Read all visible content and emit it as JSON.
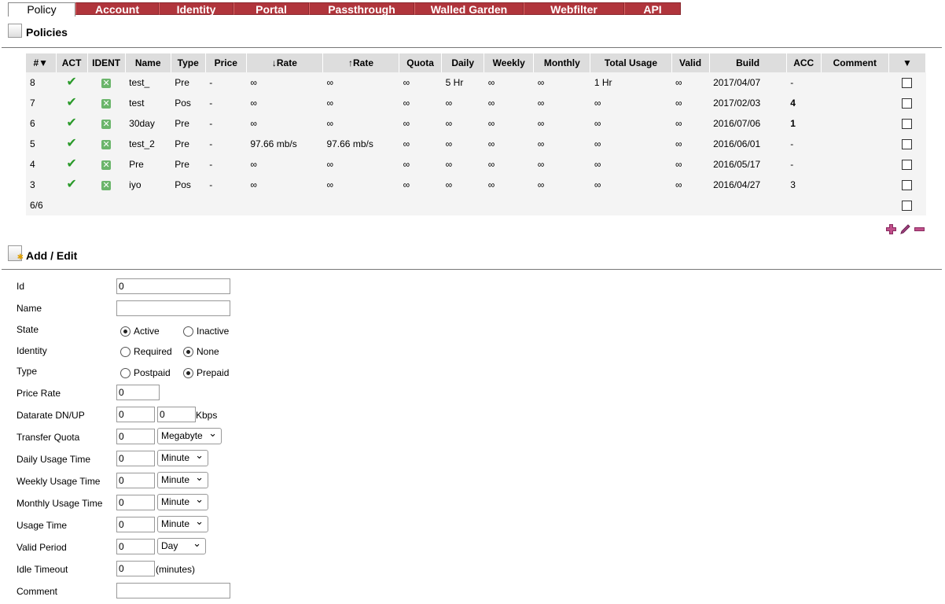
{
  "tabs": [
    "Policy",
    "Account",
    "Identity",
    "Portal",
    "Passthrough",
    "Walled Garden",
    "Webfilter",
    "API"
  ],
  "policies_title": "Policies",
  "addedit_title": "Add / Edit",
  "table": {
    "headers": [
      "#▼",
      "ACT",
      "IDENT",
      "Name",
      "Type",
      "Price",
      "↓Rate",
      "↑Rate",
      "Quota",
      "Daily",
      "Weekly",
      "Monthly",
      "Total Usage",
      "Valid",
      "Build",
      "ACC",
      "Comment",
      "▼"
    ],
    "rows": [
      {
        "id": "8",
        "name": "test_",
        "type": "Pre",
        "price": "-",
        "down": "∞",
        "up": "∞",
        "quota": "∞",
        "daily": "5 Hr",
        "weekly": "∞",
        "monthly": "∞",
        "total": "1 Hr",
        "valid": "∞",
        "build": "2017/04/07",
        "acc": "-",
        "comment": ""
      },
      {
        "id": "7",
        "name": "test",
        "type": "Pos",
        "price": "-",
        "down": "∞",
        "up": "∞",
        "quota": "∞",
        "daily": "∞",
        "weekly": "∞",
        "monthly": "∞",
        "total": "∞",
        "valid": "∞",
        "build": "2017/02/03",
        "acc": "4",
        "comment": ""
      },
      {
        "id": "6",
        "name": "30day",
        "type": "Pre",
        "price": "-",
        "down": "∞",
        "up": "∞",
        "quota": "∞",
        "daily": "∞",
        "weekly": "∞",
        "monthly": "∞",
        "total": "∞",
        "valid": "∞",
        "build": "2016/07/06",
        "acc": "1",
        "comment": ""
      },
      {
        "id": "5",
        "name": "test_2",
        "type": "Pre",
        "price": "-",
        "down": "97.66 mb/s",
        "up": "97.66 mb/s",
        "quota": "∞",
        "daily": "∞",
        "weekly": "∞",
        "monthly": "∞",
        "total": "∞",
        "valid": "∞",
        "build": "2016/06/01",
        "acc": "-",
        "comment": ""
      },
      {
        "id": "4",
        "name": "Pre",
        "type": "Pre",
        "price": "-",
        "down": "∞",
        "up": "∞",
        "quota": "∞",
        "daily": "∞",
        "weekly": "∞",
        "monthly": "∞",
        "total": "∞",
        "valid": "∞",
        "build": "2016/05/17",
        "acc": "-",
        "comment": ""
      },
      {
        "id": "3",
        "name": "iyo",
        "type": "Pos",
        "price": "-",
        "down": "∞",
        "up": "∞",
        "quota": "∞",
        "daily": "∞",
        "weekly": "∞",
        "monthly": "∞",
        "total": "∞",
        "valid": "∞",
        "build": "2016/04/27",
        "acc": "3",
        "comment": ""
      }
    ],
    "footer_count": "6/6"
  },
  "form": {
    "id_label": "Id",
    "id_value": "0",
    "name_label": "Name",
    "name_value": "",
    "state_label": "State",
    "state_active": "Active",
    "state_inactive": "Inactive",
    "identity_label": "Identity",
    "identity_required": "Required",
    "identity_none": "None",
    "type_label": "Type",
    "type_postpaid": "Postpaid",
    "type_prepaid": "Prepaid",
    "price_label": "Price Rate",
    "price_value": "0",
    "datarate_label": "Datarate DN/UP",
    "dn_value": "0",
    "up_value": "0",
    "datarate_unit": "Kbps",
    "quota_label": "Transfer Quota",
    "quota_value": "0",
    "quota_unit": "Megabyte",
    "daily_label": "Daily Usage Time",
    "daily_value": "0",
    "daily_unit": "Minute",
    "weekly_label": "Weekly Usage Time",
    "weekly_value": "0",
    "weekly_unit": "Minute",
    "monthly_label": "Monthly Usage Time",
    "monthly_value": "0",
    "monthly_unit": "Minute",
    "usage_label": "Usage Time",
    "usage_value": "0",
    "usage_unit": "Minute",
    "valid_label": "Valid Period",
    "valid_value": "0",
    "valid_unit": "Day",
    "idle_label": "Idle Timeout",
    "idle_value": "0",
    "idle_unit": "(minutes)",
    "comment_label": "Comment",
    "comment_value": ""
  },
  "colors": {
    "tab_bg": "#b0353c",
    "header_bg": "#dddddd",
    "table_bg": "#f4f4f4",
    "check_green": "#2a9a2a"
  }
}
